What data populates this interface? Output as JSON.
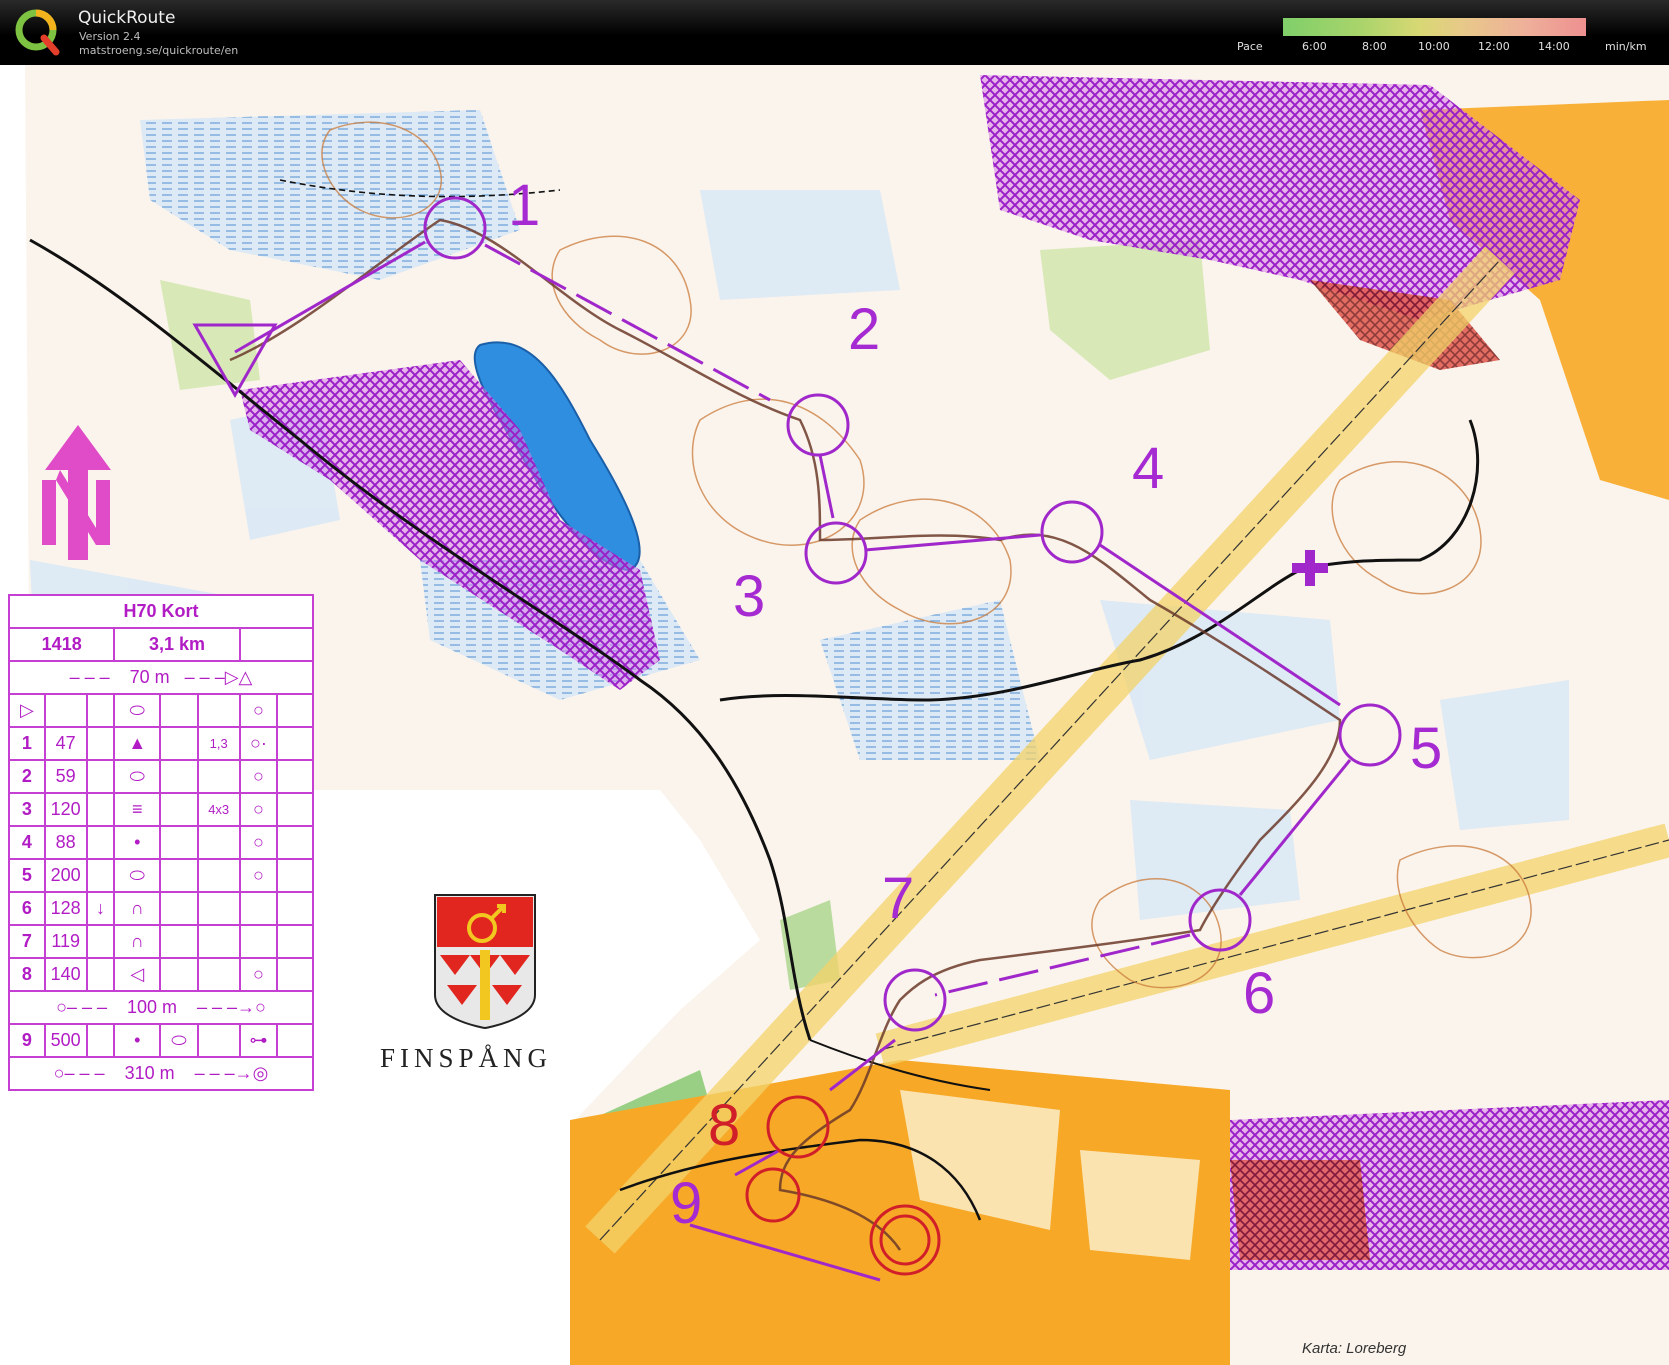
{
  "app": {
    "title": "QuickRoute",
    "version": "Version 2.4",
    "url": "matstroeng.se/quickroute/en"
  },
  "pace_legend": {
    "label": "Pace",
    "ticks": [
      "6:00",
      "8:00",
      "10:00",
      "12:00",
      "14:00"
    ],
    "unit": "min/km",
    "gradient_colors": [
      "#7fcf6a",
      "#d8d874",
      "#ee9090"
    ]
  },
  "course": {
    "class": "H70 Kort",
    "code": "1418",
    "length": "3,1 km",
    "start_leg": "70 m",
    "rows": [
      {
        "n": "",
        "code": "",
        "c3": "",
        "c4": "",
        "c5": "",
        "c6": "",
        "c7": ""
      },
      {
        "n": "1",
        "code": "47",
        "dims": "1,3"
      },
      {
        "n": "2",
        "code": "59",
        "dims": ""
      },
      {
        "n": "3",
        "code": "120",
        "dims": "4x3"
      },
      {
        "n": "4",
        "code": "88",
        "dims": ""
      },
      {
        "n": "5",
        "code": "200",
        "dims": ""
      },
      {
        "n": "6",
        "code": "128",
        "dims": ""
      },
      {
        "n": "7",
        "code": "119",
        "dims": ""
      },
      {
        "n": "8",
        "code": "140",
        "dims": ""
      }
    ],
    "leg_to_9": "100 m",
    "row9": {
      "n": "9",
      "code": "500"
    },
    "finish_leg": "310 m"
  },
  "control_numbers": [
    "1",
    "2",
    "3",
    "4",
    "5",
    "6",
    "7",
    "8",
    "9"
  ],
  "map_text": {
    "municipality": "FINSPÅNG",
    "credit": "Karta: Loreberg"
  },
  "colors": {
    "course": "#b128c8",
    "route": "#6b3a2a",
    "forest_open": "#f6a51c",
    "water": "#bcd9f2",
    "lake": "#2f8ee0",
    "oob": "#9b30d0"
  }
}
